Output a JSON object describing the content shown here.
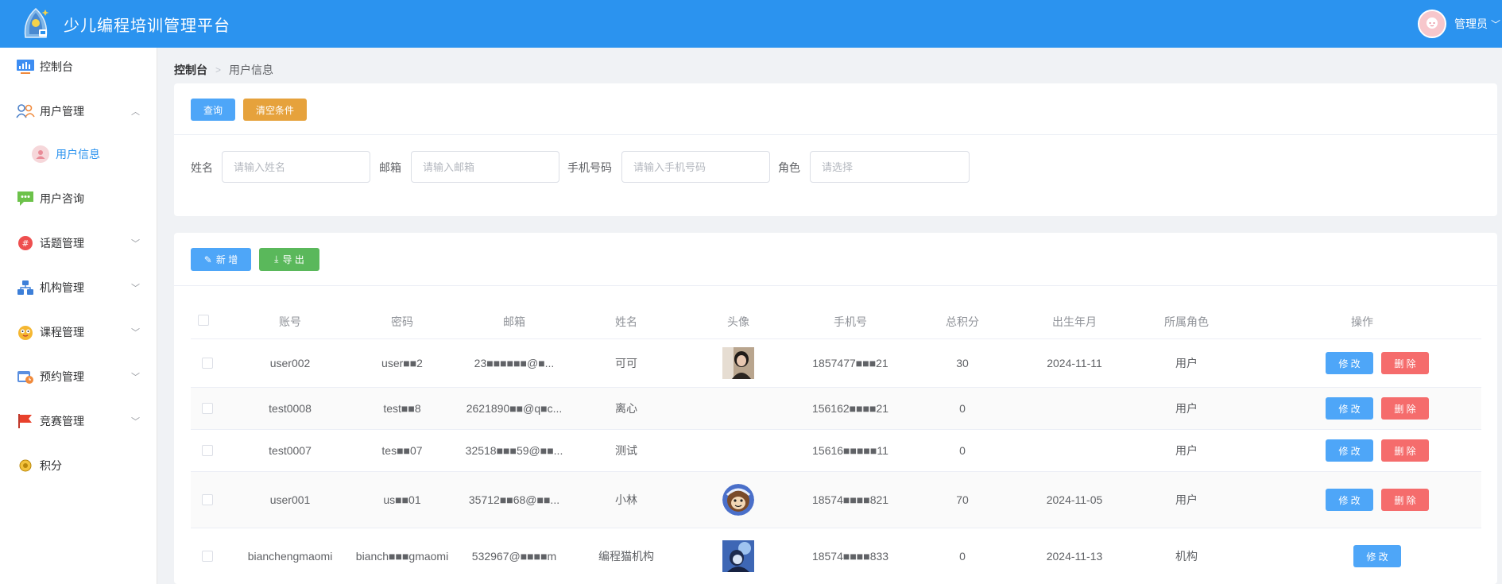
{
  "header": {
    "title": "少儿编程培训管理平台",
    "user_name": "管理员"
  },
  "sidebar": {
    "items": [
      {
        "label": "控制台",
        "icon": "monitor-icon"
      },
      {
        "label": "用户管理",
        "icon": "users-icon"
      },
      {
        "label": "用户信息",
        "icon": "user-avatar-icon"
      },
      {
        "label": "用户咨询",
        "icon": "chat-icon"
      },
      {
        "label": "话题管理",
        "icon": "hashtag-icon"
      },
      {
        "label": "机构管理",
        "icon": "org-icon"
      },
      {
        "label": "课程管理",
        "icon": "mascot-icon"
      },
      {
        "label": "预约管理",
        "icon": "calendar-icon"
      },
      {
        "label": "竞赛管理",
        "icon": "flag-icon"
      },
      {
        "label": "积分",
        "icon": "coin-icon"
      }
    ]
  },
  "breadcrumb": {
    "root": "控制台",
    "current": "用户信息"
  },
  "search": {
    "query_label": "查询",
    "clear_label": "清空条件",
    "name_label": "姓名",
    "name_placeholder": "请输入姓名",
    "email_label": "邮箱",
    "email_placeholder": "请输入邮箱",
    "phone_label": "手机号码",
    "phone_placeholder": "请输入手机号码",
    "role_label": "角色",
    "role_placeholder": "请选择"
  },
  "actions": {
    "add_label": "新 增",
    "export_label": "导 出"
  },
  "table": {
    "columns": [
      "账号",
      "密码",
      "邮箱",
      "姓名",
      "头像",
      "手机号",
      "总积分",
      "出生年月",
      "所属角色",
      "操作"
    ],
    "edit_label": "修 改",
    "delete_label": "删 除",
    "rows": [
      {
        "account": "user002",
        "password": "user■■2",
        "email": "23■■■■■■@■...",
        "name": "可可",
        "avatar": "photo",
        "phone": "1857477■■■21",
        "points": "30",
        "birth": "2024-11-11",
        "role": "用户",
        "deletable": true
      },
      {
        "account": "test0008",
        "password": "test■■8",
        "email": "2621890■■@q■c...",
        "name": "离心",
        "avatar": "",
        "phone": "156162■■■■21",
        "points": "0",
        "birth": "",
        "role": "用户",
        "deletable": true
      },
      {
        "account": "test0007",
        "password": "tes■■07",
        "email": "32518■■■59@■■...",
        "name": "测试",
        "avatar": "",
        "phone": "15616■■■■■11",
        "points": "0",
        "birth": "",
        "role": "用户",
        "deletable": true
      },
      {
        "account": "user001",
        "password": "us■■01",
        "email": "35712■■68@■■...",
        "name": "小林",
        "avatar": "monkey",
        "phone": "18574■■■■821",
        "points": "70",
        "birth": "2024-11-05",
        "role": "用户",
        "deletable": true
      },
      {
        "account": "bianchengmaomi",
        "password": "bianch■■■gmaomi",
        "email": "532967@■■■■m",
        "name": "编程猫机构",
        "avatar": "photo2",
        "phone": "18574■■■■833",
        "points": "0",
        "birth": "2024-11-13",
        "role": "机构",
        "deletable": false
      }
    ]
  }
}
